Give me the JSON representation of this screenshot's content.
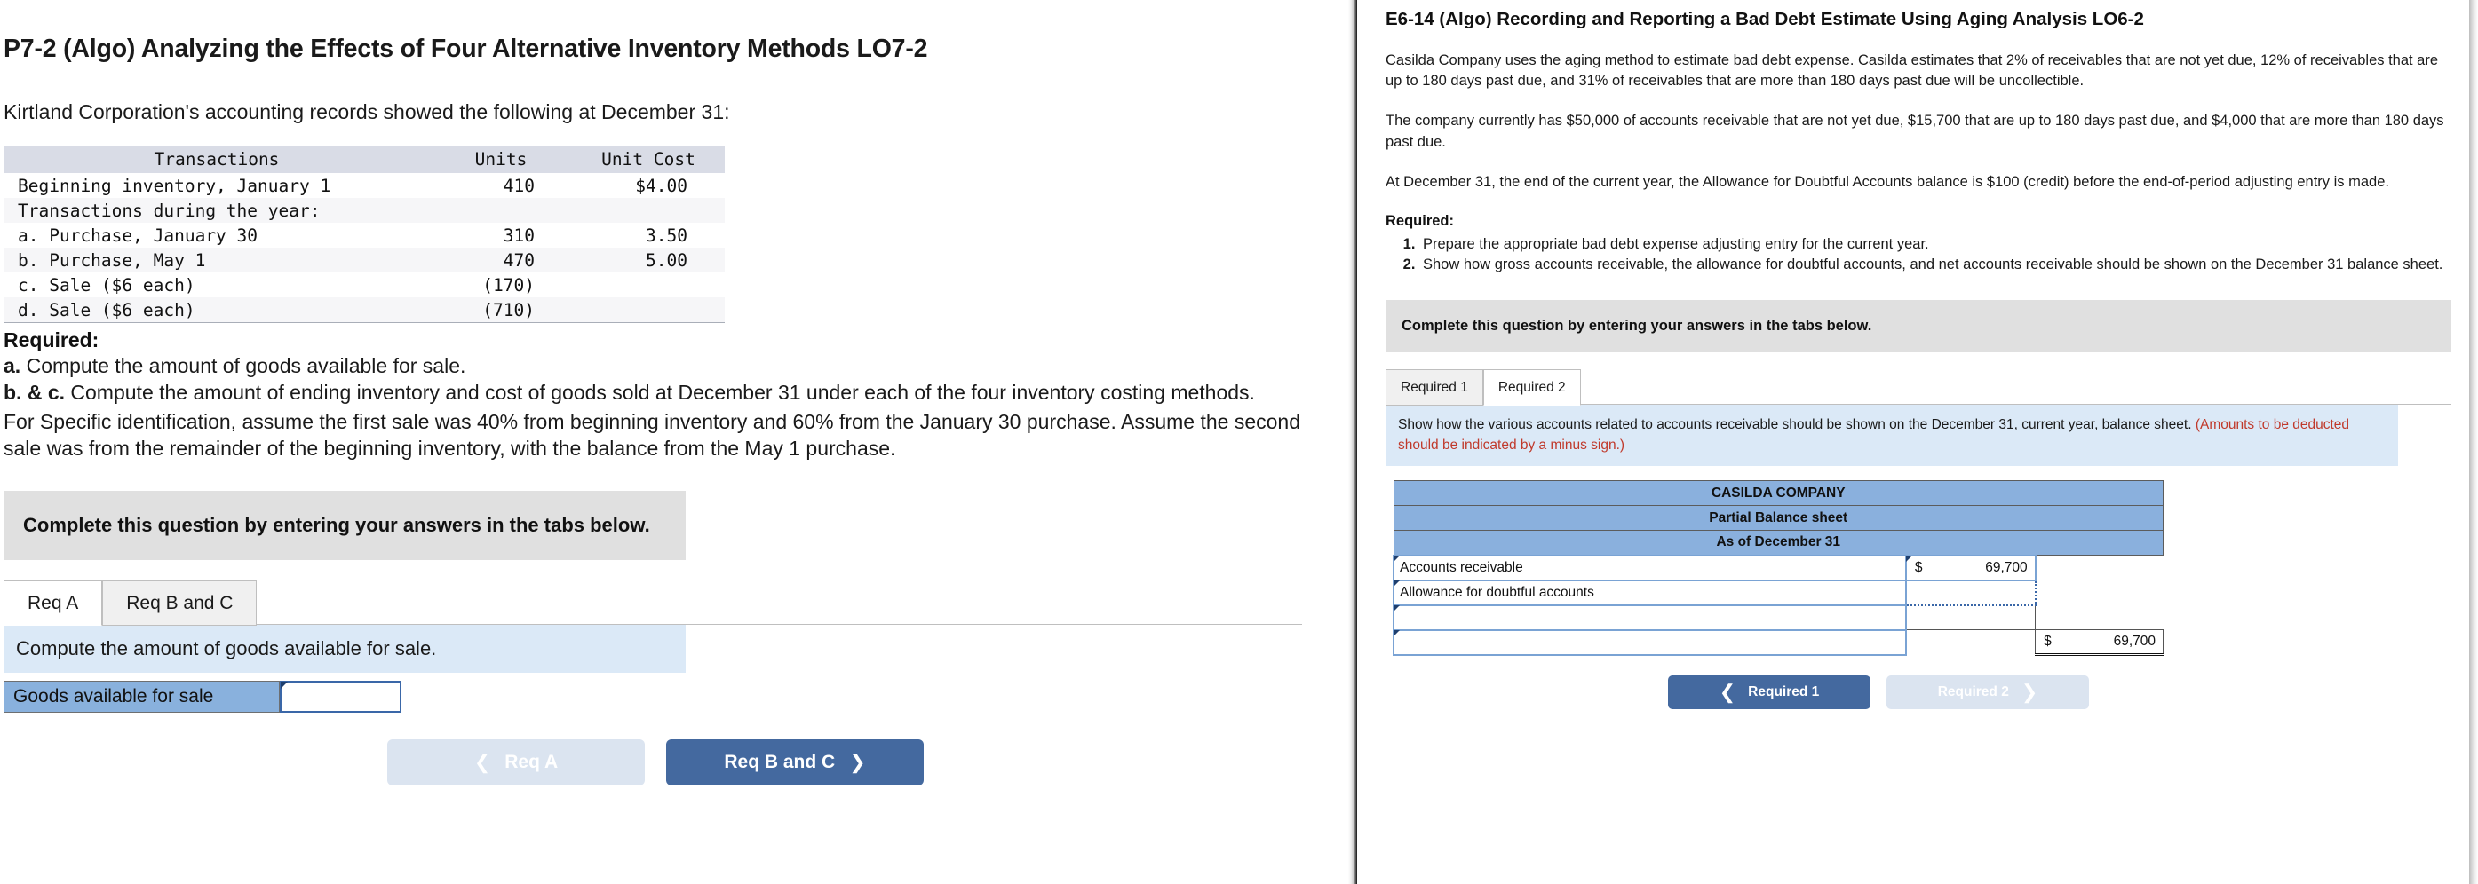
{
  "left": {
    "title": "P7-2 (Algo) Analyzing the Effects of Four Alternative Inventory Methods LO7-2",
    "intro": "Kirtland Corporation's accounting records showed the following at December 31:",
    "table": {
      "headers": [
        "Transactions",
        "Units",
        "Unit Cost"
      ],
      "rows": [
        {
          "label": "Beginning inventory, January 1",
          "units": "410",
          "cost": "$4.00"
        },
        {
          "label": "Transactions during the year:",
          "units": "",
          "cost": ""
        },
        {
          "label": "a. Purchase, January 30",
          "units": "310",
          "cost": "3.50"
        },
        {
          "label": "b. Purchase, May 1",
          "units": "470",
          "cost": "5.00"
        },
        {
          "label": "c. Sale ($6 each)",
          "units": "(170)",
          "cost": ""
        },
        {
          "label": "d. Sale ($6 each)",
          "units": "(710)",
          "cost": ""
        }
      ]
    },
    "required_heading": "Required:",
    "req_a_marker": "a.",
    "req_a_text": "Compute the amount of goods available for sale.",
    "req_bc_marker": "b. & c.",
    "req_bc_text": "Compute the amount of ending inventory and cost of goods sold at December 31 under each of the four inventory costing methods.",
    "req_note": "For Specific identification, assume the first sale was 40% from beginning inventory and 60% from the January 30 purchase. Assume the second sale was from the remainder of the beginning inventory, with the balance from the May 1 purchase.",
    "complete_banner": "Complete this question by entering your answers in the tabs below.",
    "tabs": [
      {
        "label": "Req A",
        "active": true
      },
      {
        "label": "Req B and C",
        "active": false
      }
    ],
    "instruction": "Compute the amount of goods available for sale.",
    "entry_row": {
      "label": "Goods available for sale",
      "value": ""
    },
    "nav": {
      "prev_label": "Req A",
      "next_label": "Req B and C",
      "prev_icon": "chevron-left-icon",
      "next_icon": "chevron-right-icon"
    }
  },
  "right": {
    "title": "E6-14 (Algo) Recording and Reporting a Bad Debt Estimate Using Aging Analysis LO6-2",
    "para1": "Casilda Company uses the aging method to estimate bad debt expense. Casilda estimates that 2% of receivables that are not yet due, 12% of receivables that are up to 180 days past due, and 31% of receivables that are more than 180 days past due will be uncollectible.",
    "para2": "The company currently has $50,000 of accounts receivable that are not yet due, $15,700 that are up to 180 days past due, and $4,000 that are more than 180 days past due.",
    "para3": "At December 31, the end of the current year, the Allowance for Doubtful Accounts balance is $100 (credit) before the end-of-period adjusting entry is made.",
    "required_heading": "Required:",
    "required_items": [
      "Prepare the appropriate bad debt expense adjusting entry for the current year.",
      "Show how gross accounts receivable, the allowance for doubtful accounts, and net accounts receivable should be shown on the December 31 balance sheet."
    ],
    "complete_banner": "Complete this question by entering your answers in the tabs below.",
    "tabs": [
      {
        "label": "Required 1",
        "active": false
      },
      {
        "label": "Required 2",
        "active": true
      }
    ],
    "instruction_main": "Show how the various accounts related to accounts receivable should be shown on the December 31, current year, balance sheet.",
    "instruction_note": "(Amounts to be deducted should be indicated by a minus sign.)",
    "balance_sheet": {
      "header_lines": [
        "CASILDA COMPANY",
        "Partial Balance sheet",
        "As of December 31"
      ],
      "rows": [
        {
          "label": "Accounts receivable",
          "currency": "$",
          "amount": "69,700",
          "col3": "",
          "col3_currency": "",
          "style": "solid"
        },
        {
          "label": "Allowance for doubtful accounts",
          "currency": "",
          "amount": "",
          "col3": "",
          "col3_currency": "",
          "style": "dotted"
        },
        {
          "label": "",
          "currency": "",
          "amount": "",
          "col3": "",
          "col3_currency": "",
          "style": "solid"
        },
        {
          "label": "",
          "currency": "",
          "amount": "",
          "col3": "69,700",
          "col3_currency": "$",
          "style": "total"
        }
      ]
    },
    "nav": {
      "prev_label": "Required 1",
      "next_label": "Required 2",
      "prev_icon": "chevron-left-icon",
      "next_icon": "chevron-right-icon"
    }
  }
}
